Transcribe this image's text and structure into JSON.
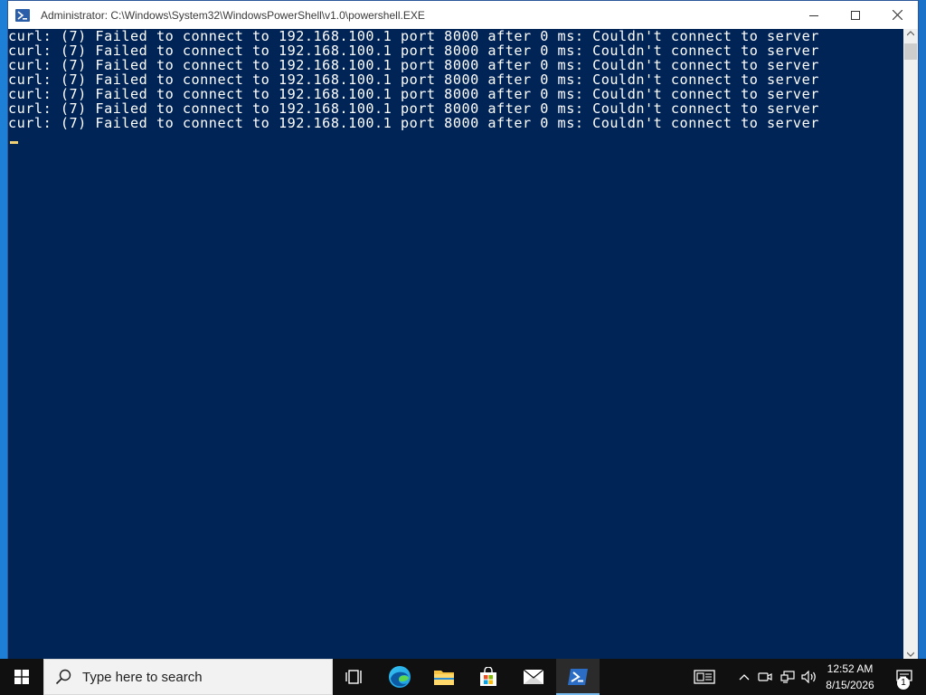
{
  "window": {
    "title": "Administrator: C:\\Windows\\System32\\WindowsPowerShell\\v1.0\\powershell.EXE"
  },
  "console": {
    "lines": [
      "curl: (7) Failed to connect to 192.168.100.1 port 8000 after 0 ms: Couldn't connect to server",
      "curl: (7) Failed to connect to 192.168.100.1 port 8000 after 0 ms: Couldn't connect to server",
      "curl: (7) Failed to connect to 192.168.100.1 port 8000 after 0 ms: Couldn't connect to server",
      "curl: (7) Failed to connect to 192.168.100.1 port 8000 after 0 ms: Couldn't connect to server",
      "curl: (7) Failed to connect to 192.168.100.1 port 8000 after 0 ms: Couldn't connect to server",
      "curl: (7) Failed to connect to 192.168.100.1 port 8000 after 0 ms: Couldn't connect to server",
      "curl: (7) Failed to connect to 192.168.100.1 port 8000 after 0 ms: Couldn't connect to server"
    ],
    "background": "#012456",
    "foreground": "#ffffff"
  },
  "taskbar": {
    "search_placeholder": "Type here to search",
    "pinned": [
      "task-view-icon",
      "edge-icon",
      "file-explorer-icon",
      "store-icon",
      "mail-icon",
      "powershell-icon"
    ],
    "clock_time": "12:52 AM",
    "clock_date": "8/15/2026",
    "notification_count": "1"
  }
}
